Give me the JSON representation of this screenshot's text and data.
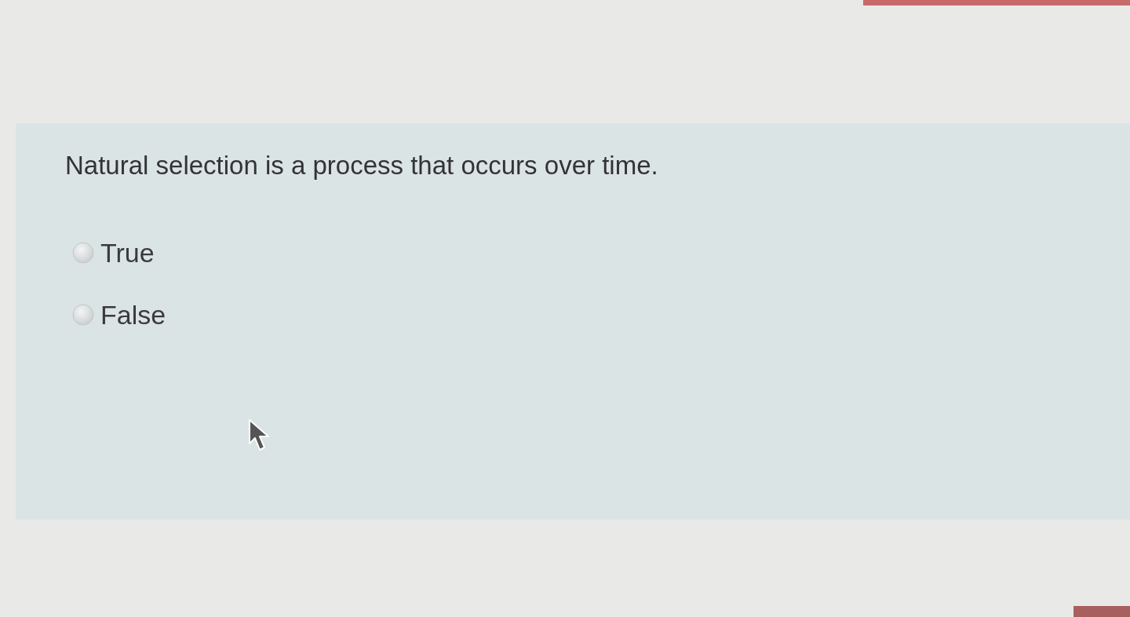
{
  "question": {
    "text": "Natural selection is a process that occurs over time.",
    "options": [
      {
        "label": "True",
        "selected": false
      },
      {
        "label": "False",
        "selected": false
      }
    ]
  }
}
